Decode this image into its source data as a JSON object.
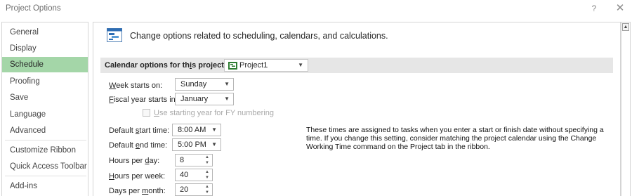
{
  "window": {
    "title": "Project Options",
    "help_label": "?",
    "close_label": "✕"
  },
  "sidebar": {
    "items": [
      {
        "label": "General",
        "selected": false
      },
      {
        "label": "Display",
        "selected": false
      },
      {
        "label": "Schedule",
        "selected": true
      },
      {
        "label": "Proofing",
        "selected": false
      },
      {
        "label": "Save",
        "selected": false
      },
      {
        "label": "Language",
        "selected": false
      },
      {
        "label": "Advanced",
        "selected": false
      },
      {
        "label": "Customize Ribbon",
        "selected": false
      },
      {
        "label": "Quick Access Toolbar",
        "selected": false
      },
      {
        "label": "Add-ins",
        "selected": false
      }
    ]
  },
  "header": {
    "text": "Change options related to scheduling, calendars, and calculations.",
    "icon": "schedule-calendar-icon"
  },
  "calendar_section": {
    "label_pre": "Calendar options for th",
    "label_u": "i",
    "label_post": "s project:",
    "project_value": "Project1",
    "project_icon": "project-file-icon"
  },
  "fields": {
    "week_starts": {
      "label_u": "W",
      "label_rest": "eek starts on:",
      "value": "Sunday"
    },
    "fiscal_year": {
      "label_u": "F",
      "label_rest": "iscal year starts in:",
      "value": "January"
    },
    "fy_numbering": {
      "label_u": "U",
      "label_rest": "se starting year for FY numbering",
      "checked": false,
      "enabled": false
    },
    "default_start": {
      "label_pre": "Default ",
      "label_u": "s",
      "label_post": "tart time:",
      "value": "8:00 AM"
    },
    "default_end": {
      "label_pre": "Default ",
      "label_u": "e",
      "label_post": "nd time:",
      "value": "5:00 PM"
    },
    "hours_day": {
      "label_pre": "Hours per ",
      "label_u": "d",
      "label_post": "ay:",
      "value": "8"
    },
    "hours_week": {
      "label_u": "H",
      "label_rest": "ours per week:",
      "value": "40"
    },
    "days_month": {
      "label_pre": "Days per ",
      "label_u": "m",
      "label_post": "onth:",
      "value": "20"
    }
  },
  "info_text": "These times are assigned to tasks when you enter a start or finish date without specifying a time. If you change this setting, consider matching the project calendar using the Change Working Time command on the Project tab in the ribbon.",
  "colors": {
    "selected_nav": "#a4d6a8",
    "section_bar": "#e6e6e6"
  }
}
